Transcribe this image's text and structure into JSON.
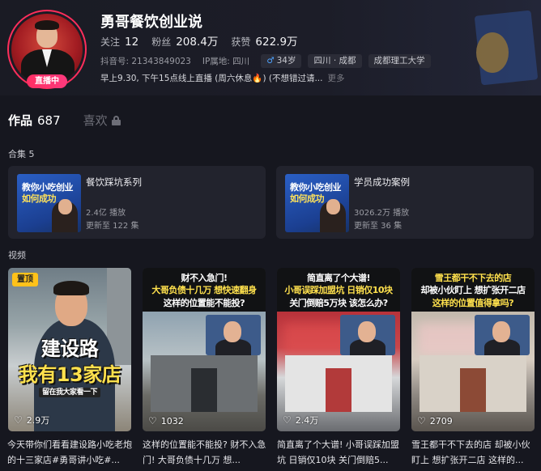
{
  "profile": {
    "nickname": "勇哥餐饮创业说",
    "live_badge": "直播中",
    "following_label": "关注",
    "following_count": "12",
    "followers_label": "粉丝",
    "followers_count": "208.4万",
    "likes_label": "获赞",
    "likes_count": "622.9万",
    "douyin_id": "抖音号: 21343849023",
    "ip_location": "IP属地: 四川",
    "gender_icon": "male-icon",
    "age_tag": "34岁",
    "location_tag": "四川 · 成都",
    "school_tag": "成都理工大学",
    "bio_text": "早上9.30, 下午15点线上直播 (周六休息",
    "bio_emoji": "🔥",
    "bio_tail": ") (不想错过请...",
    "bio_more": "更多"
  },
  "tabs": {
    "works_label": "作品",
    "works_count": "687",
    "likes_tab_label": "喜欢"
  },
  "collections": {
    "section_label": "合集 5",
    "items": [
      {
        "title": "餐饮踩坑系列",
        "plays": "2.4亿 播放",
        "updates": "更新至 122 集",
        "thumb_line1": "教你小吃创业",
        "thumb_line2": "如何成功"
      },
      {
        "title": "学员成功案例",
        "plays": "3026.2万 播放",
        "updates": "更新至 36 集",
        "thumb_line1": "教你小吃创业",
        "thumb_line2": "如何成功"
      }
    ]
  },
  "videos": {
    "section_label": "视频",
    "items": [
      {
        "pinned": "置顶",
        "overlay_line1": "建设路",
        "overlay_line2": "我有13家店",
        "overlay_small": "留在我大家看一下",
        "likes": "2.9万",
        "caption": "今天带你们看看建设路小吃老炮的十三家店#勇哥讲小吃#..."
      },
      {
        "overlay_line1": "财不入急门!",
        "overlay_line2": "大哥负债十几万 想快速翻身",
        "overlay_line3": "这样的位置能不能投?",
        "likes": "1032",
        "caption": "这样的位置能不能投? 财不入急门! 大哥负债十几万 想..."
      },
      {
        "overlay_line1": "简直离了个大谱!",
        "overlay_line2": "小哥误踩加盟坑 日销仅10块",
        "overlay_line3": "关门倒赔5万块 该怎么办?",
        "likes": "2.4万",
        "caption": "简直离了个大谱! 小哥误踩加盟坑 日销仅10块 关门倒赔5..."
      },
      {
        "overlay_line1": "雪王都干不下去的店",
        "overlay_line2": "却被小伙盯上 想扩张开二店",
        "overlay_line3": "这样的位置值得拿吗?",
        "likes": "2709",
        "caption": "雪王都干不下去的店 却被小伙盯上 想扩张开二店 这样的..."
      }
    ]
  },
  "colors": {
    "background": "#16171f",
    "live_accent": "#ff2e5b",
    "pin_badge": "#ffc21a"
  }
}
